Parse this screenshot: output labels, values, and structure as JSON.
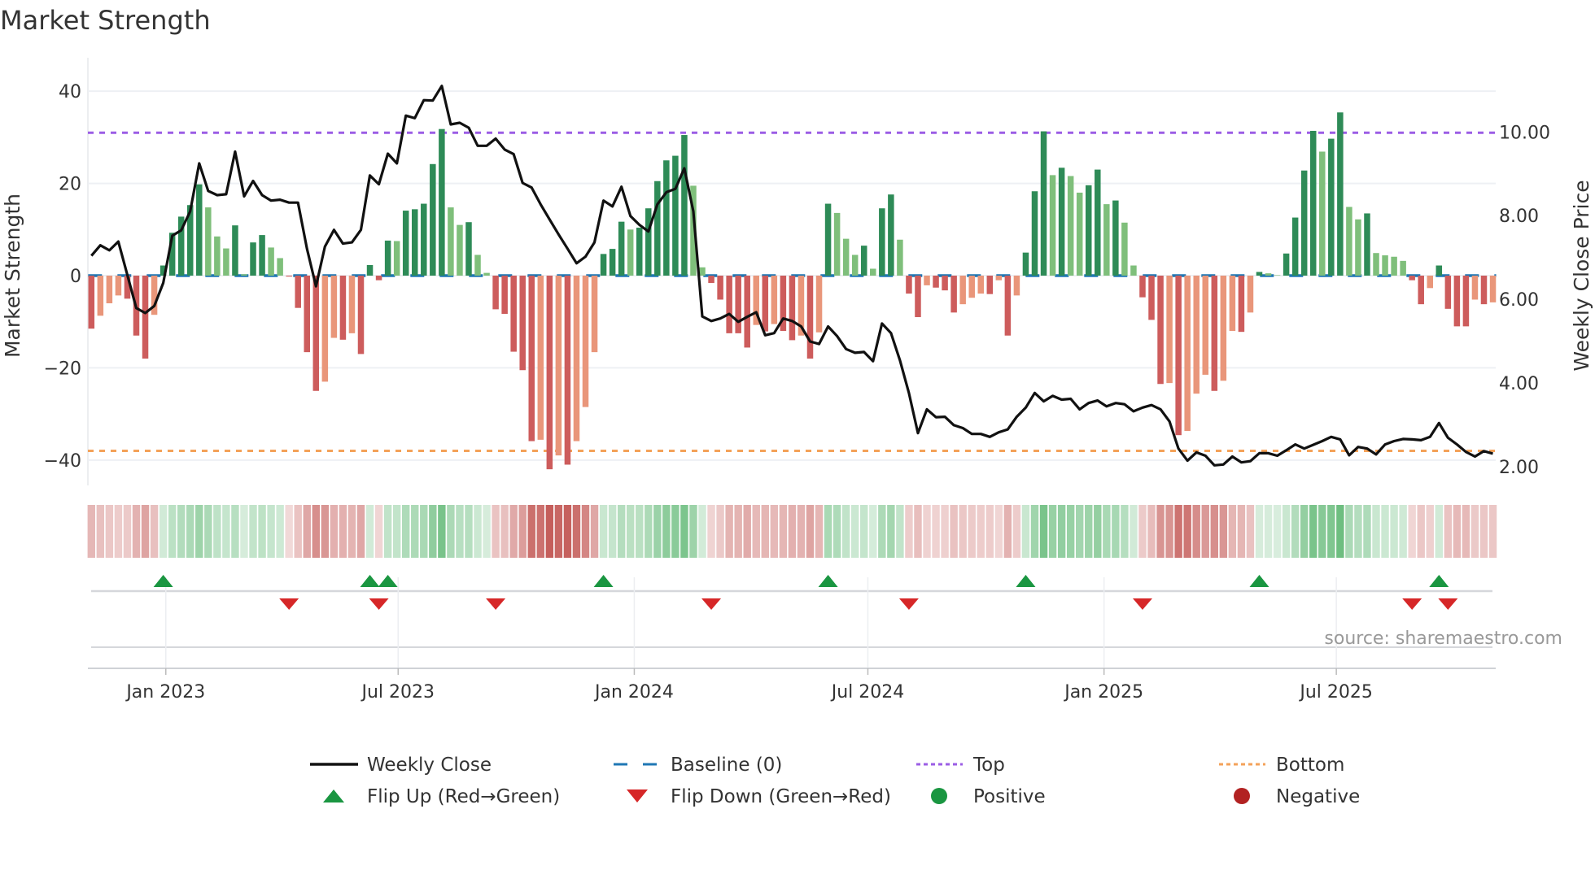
{
  "title": "Market Strength",
  "source": "source: sharemaestro.com",
  "colors": {
    "pos_strong": "#2e8b57",
    "pos_weak": "#7fbf7b",
    "neg_strong": "#cd5c5c",
    "neg_weak": "#e9967a",
    "price": "#111111",
    "baseline": "#1f77b4",
    "top": "#9b5de5",
    "bottom": "#f4a259",
    "flip_up": "#1a9641",
    "flip_down": "#d62728",
    "positive": "#1a9641",
    "negative": "#b22222"
  },
  "chart_data": {
    "type": "bar+line",
    "title": "Market Strength",
    "ylabel": "Market Strength",
    "y2label": "Weekly Close Price",
    "ylim": [
      -45.5,
      45.5
    ],
    "y2lim": [
      1.55,
      11.58
    ],
    "yticks": [
      40,
      20,
      0,
      -20,
      -40
    ],
    "ytick_labels": [
      "40",
      "20",
      "0",
      "−20",
      "−40"
    ],
    "y2ticks": [
      10,
      8,
      6,
      4,
      2
    ],
    "y2tick_labels": [
      "10.00",
      "8.00",
      "6.00",
      "4.00",
      "2.00"
    ],
    "xticks": [
      "2023-01-01",
      "2023-07-01",
      "2024-01-01",
      "2024-07-01",
      "2025-01-01",
      "2025-07-01"
    ],
    "xtick_labels": [
      "Jan 2023",
      "Jul 2023",
      "Jan 2024",
      "Jul 2024",
      "Jan 2025",
      "Jul 2025"
    ],
    "start_date": "2022-11-04",
    "interval": "weekly",
    "top_level": 31,
    "bottom_level": -38,
    "grid": true,
    "strength": [
      -11.5,
      -8.7,
      -6,
      -4.3,
      -5,
      -13,
      -18,
      -8.5,
      2.2,
      9.3,
      12.8,
      15.3,
      19.8,
      14.8,
      8.5,
      5.9,
      10.9,
      0.3,
      7.2,
      8.8,
      6.1,
      3.8,
      -0.2,
      -7,
      -16.6,
      -25,
      -23,
      -13.5,
      -13.9,
      -12.5,
      -17,
      2.3,
      -1,
      7.6,
      7.5,
      14.1,
      14.4,
      15.6,
      24.2,
      31.8,
      14.8,
      11,
      11.6,
      4.5,
      0.6,
      -7.3,
      -8.3,
      -16.5,
      -20.5,
      -35.9,
      -35.6,
      -42,
      -39,
      -41,
      -35.9,
      -28.5,
      -16.6,
      4.7,
      5.8,
      11.7,
      10,
      10.4,
      14.6,
      20.5,
      25,
      26,
      30.5,
      19.5,
      1.8,
      -1.6,
      -5.2,
      -12.5,
      -12.5,
      -15.6,
      -10.7,
      -12.1,
      -10.5,
      -12,
      -14,
      -13,
      -18,
      -12.3,
      15.6,
      13.6,
      8,
      4.5,
      6.5,
      1.5,
      14.6,
      17.6,
      7.8,
      -3.9,
      -9,
      -2.1,
      -2.6,
      -3.2,
      -8,
      -6.2,
      -4.8,
      -3.9,
      -4,
      -1,
      -13,
      -4.3,
      5,
      18.3,
      31.3,
      21.8,
      23.4,
      21.6,
      18,
      19.6,
      23,
      15.5,
      16.3,
      11.5,
      2.2,
      -4.7,
      -9.6,
      -23.5,
      -23.3,
      -34.6,
      -33.7,
      -25.6,
      -21.5,
      -25,
      -22.8,
      -12,
      -12.2,
      -8,
      0.8,
      0.5,
      0.1,
      4.8,
      12.6,
      22.8,
      31.4,
      26.9,
      29.7,
      35.4,
      14.9,
      12.2,
      13.5,
      4.9,
      4.4,
      4.1,
      3.2,
      -1,
      -6.2,
      -2.7,
      2.2,
      -7.2,
      -11,
      -11,
      -5.2,
      -6.2,
      -5.8
    ],
    "price": [
      7.04,
      7.29,
      7.17,
      7.38,
      6.58,
      5.79,
      5.67,
      5.84,
      6.39,
      7.52,
      7.65,
      8.1,
      9.25,
      8.59,
      8.49,
      8.51,
      9.53,
      8.46,
      8.83,
      8.49,
      8.36,
      8.38,
      8.31,
      8.31,
      7.2,
      6.31,
      7.26,
      7.66,
      7.33,
      7.36,
      7.66,
      8.96,
      8.75,
      9.48,
      9.25,
      10.39,
      10.33,
      10.76,
      10.75,
      11.1,
      10.18,
      10.22,
      10.1,
      9.67,
      9.67,
      9.84,
      9.58,
      9.47,
      8.78,
      8.67,
      8.27,
      7.91,
      7.55,
      7.21,
      6.86,
      7.02,
      7.36,
      8.36,
      8.22,
      8.69,
      7.99,
      7.78,
      7.62,
      8.27,
      8.56,
      8.64,
      9.13,
      8.1,
      5.59,
      5.48,
      5.54,
      5.65,
      5.46,
      5.58,
      5.69,
      5.14,
      5.19,
      5.54,
      5.48,
      5.35,
      4.99,
      4.93,
      5.35,
      5.12,
      4.81,
      4.72,
      4.74,
      4.52,
      5.42,
      5.19,
      4.54,
      3.76,
      2.8,
      3.37,
      3.18,
      3.19,
      2.99,
      2.92,
      2.78,
      2.78,
      2.71,
      2.82,
      2.89,
      3.19,
      3.41,
      3.76,
      3.56,
      3.69,
      3.6,
      3.62,
      3.37,
      3.52,
      3.58,
      3.44,
      3.52,
      3.49,
      3.32,
      3.41,
      3.47,
      3.37,
      3.08,
      2.43,
      2.14,
      2.34,
      2.26,
      2.03,
      2.05,
      2.24,
      2.1,
      2.13,
      2.32,
      2.32,
      2.26,
      2.39,
      2.53,
      2.43,
      2.52,
      2.61,
      2.71,
      2.65,
      2.27,
      2.47,
      2.43,
      2.29,
      2.53,
      2.61,
      2.66,
      2.65,
      2.63,
      2.71,
      3.04,
      2.69,
      2.53,
      2.35,
      2.24,
      2.37,
      2.31
    ],
    "flips_up_week_index": [
      9,
      32,
      34,
      58,
      83,
      105,
      131,
      151
    ],
    "flips_down_week_index": [
      23,
      33,
      46,
      70,
      92,
      118,
      148,
      152
    ],
    "legend": {
      "placement": "bottom",
      "items": [
        {
          "label": "Weekly Close",
          "kind": "line"
        },
        {
          "label": "Baseline (0)",
          "kind": "dash"
        },
        {
          "label": "Top",
          "kind": "dot-top"
        },
        {
          "label": "Bottom",
          "kind": "dot-bottom"
        },
        {
          "label": "Flip Up (Red→Green)",
          "kind": "tri-up"
        },
        {
          "label": "Flip Down (Green→Red)",
          "kind": "tri-down"
        },
        {
          "label": "Positive",
          "kind": "circle-pos"
        },
        {
          "label": "Negative",
          "kind": "circle-neg"
        }
      ]
    }
  }
}
